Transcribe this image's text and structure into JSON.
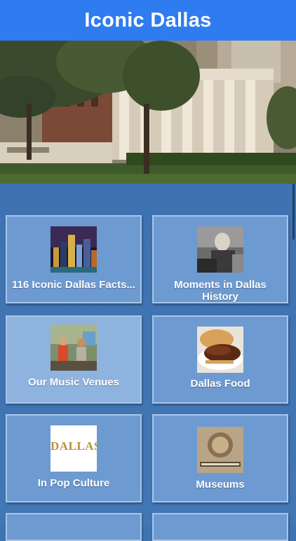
{
  "app": {
    "title": "Iconic Dallas"
  },
  "tiles": [
    {
      "label": "116 Iconic Dallas Facts...",
      "icon": "city-skyline-thumbnail"
    },
    {
      "label": "Moments in Dallas History",
      "icon": "historic-photo-thumbnail"
    },
    {
      "label": "Our Music Venues",
      "icon": "music-venue-thumbnail"
    },
    {
      "label": "Dallas Food",
      "icon": "brisket-food-thumbnail"
    },
    {
      "label": "In Pop Culture",
      "icon": "dallas-logo-thumbnail",
      "logo_text": "DALLAS"
    },
    {
      "label": "Museums",
      "icon": "museum-sign-thumbnail"
    }
  ],
  "colors": {
    "topbar": "#2f7cf0",
    "grid_background": "#3f74b4",
    "tile": "#6d9ad0",
    "tile_highlight": "#8fb3df",
    "tile_border": "#a9c6ea"
  }
}
